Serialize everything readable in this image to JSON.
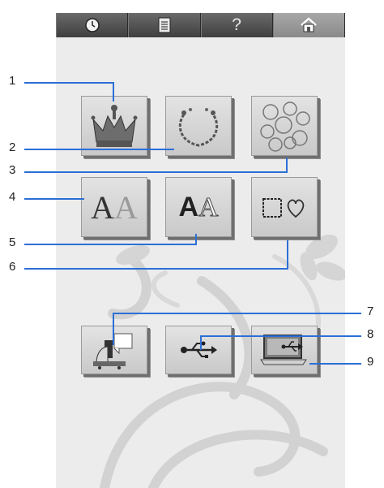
{
  "topbar": {
    "items": [
      {
        "icon": "clock-icon"
      },
      {
        "icon": "document-icon"
      },
      {
        "label": "?",
        "icon": "help-icon"
      },
      {
        "icon": "home-icon"
      }
    ]
  },
  "buttons": {
    "crown": {
      "icon": "crown-icon"
    },
    "wreath": {
      "icon": "wreath-icon"
    },
    "quilt": {
      "icon": "floral-pattern-icon"
    },
    "decorative_font": {
      "letter_a": "A",
      "letter_b": "A",
      "icon": "decorative-alphabet-icon"
    },
    "plain_font": {
      "letter_a": "A",
      "letter_b": "A",
      "icon": "alphabet-icon"
    },
    "frame": {
      "icon": "frame-shapes-icon"
    },
    "machine": {
      "icon": "embroidery-machine-icon"
    },
    "usb": {
      "icon": "usb-icon"
    },
    "computer": {
      "icon": "computer-usb-icon"
    }
  },
  "callouts": [
    "1",
    "2",
    "3",
    "4",
    "5",
    "6",
    "7",
    "8",
    "9"
  ],
  "colors": {
    "callout_line": "#2c6fd6",
    "screen_bg": "#ececec",
    "topbar": "#4f4f4f"
  }
}
